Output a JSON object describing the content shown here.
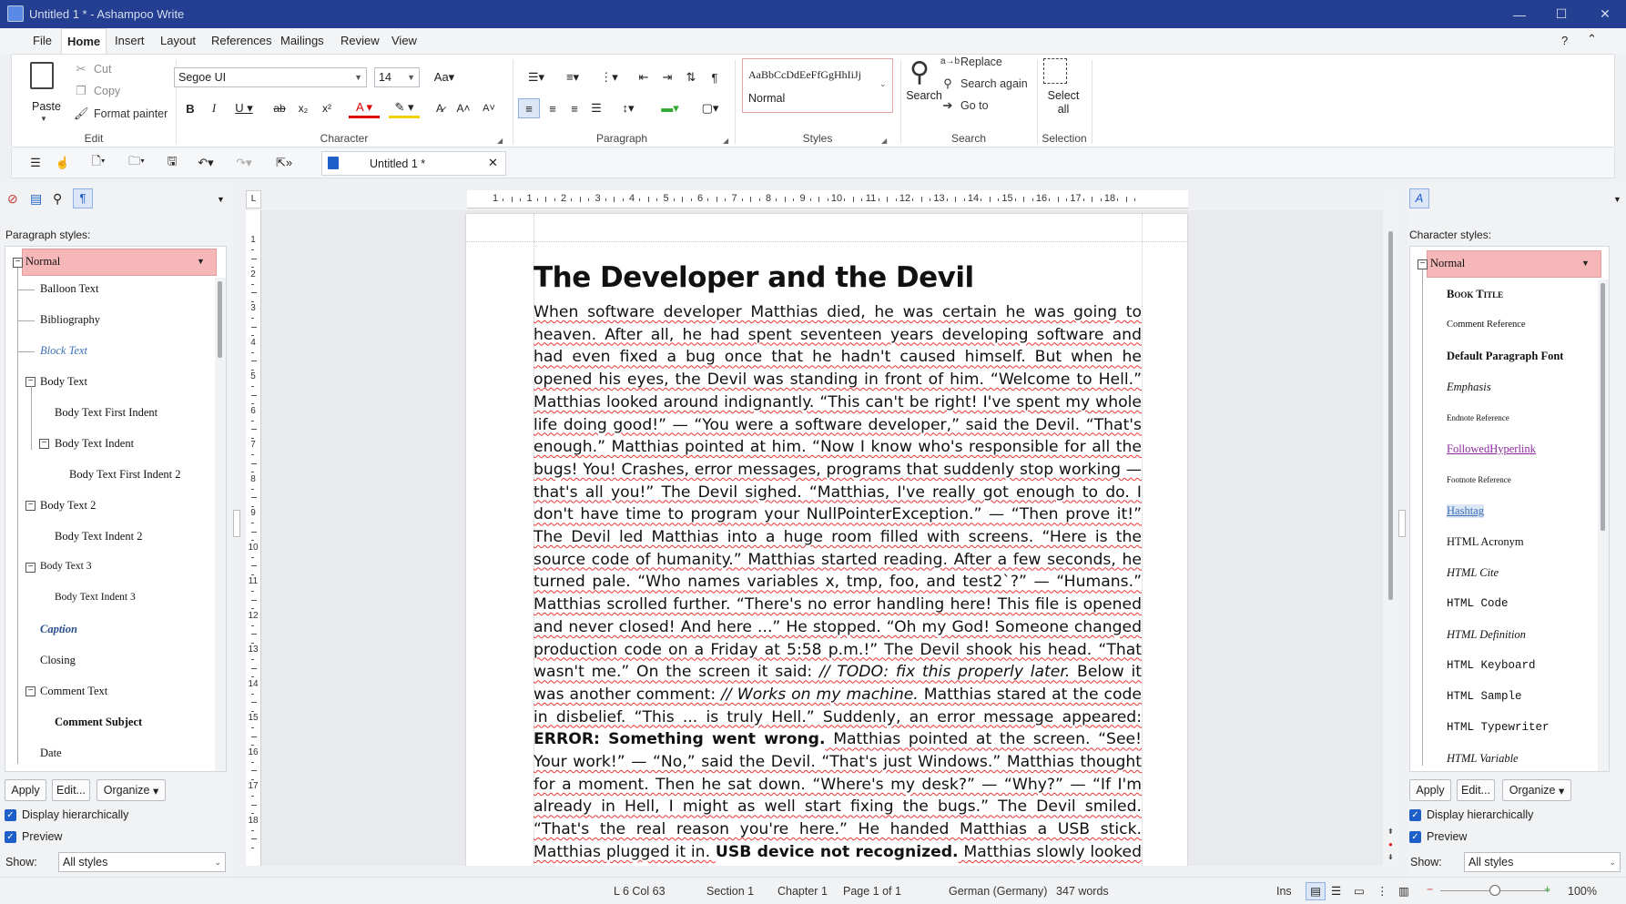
{
  "window": {
    "title": "Untitled 1 * - Ashampoo Write"
  },
  "menu": {
    "items": [
      "File",
      "Home",
      "Insert",
      "Layout",
      "References",
      "Mailings",
      "Review",
      "View"
    ],
    "active": "Home"
  },
  "ribbon": {
    "edit": {
      "label": "Edit",
      "paste": "Paste",
      "cut": "Cut",
      "copy": "Copy",
      "format_painter": "Format painter"
    },
    "character": {
      "label": "Character",
      "font": "Segoe UI",
      "size": "14"
    },
    "paragraph": {
      "label": "Paragraph"
    },
    "styles": {
      "label": "Styles",
      "preview": "AaBbCcDdEeFfGgHhIiJj",
      "current": "Normal"
    },
    "search": {
      "label": "Search",
      "search": "Search",
      "replace": "Replace",
      "search_again": "Search again",
      "go_to": "Go to"
    },
    "selection": {
      "label": "Selection",
      "select_all_line1": "Select",
      "select_all_line2": "all"
    }
  },
  "doc_tab": {
    "title": "Untitled 1 *"
  },
  "left_panel": {
    "label": "Paragraph styles:",
    "items": [
      "Normal",
      "Balloon Text",
      "Bibliography",
      "Block Text",
      "Body Text",
      "Body Text First Indent",
      "Body Text Indent",
      "Body Text First Indent 2",
      "Body Text 2",
      "Body Text Indent 2",
      "Body Text 3",
      "Body Text Indent 3",
      "Caption",
      "Closing",
      "Comment Text",
      "Comment Subject",
      "Date"
    ],
    "apply": "Apply",
    "edit": "Edit...",
    "organize": "Organize",
    "display_hier": "Display hierarchically",
    "preview": "Preview",
    "show_label": "Show:",
    "show_value": "All styles"
  },
  "right_panel": {
    "label": "Character styles:",
    "items": [
      "Normal",
      "Book Title",
      "Comment Reference",
      "Default Paragraph Font",
      "Emphasis",
      "Endnote Reference",
      "FollowedHyperlink",
      "Footnote Reference",
      "Hashtag",
      "HTML Acronym",
      "HTML Cite",
      "HTML Code",
      "HTML Definition",
      "HTML Keyboard",
      "HTML Sample",
      "HTML Typewriter",
      "HTML Variable"
    ],
    "apply": "Apply",
    "edit": "Edit...",
    "organize": "Organize",
    "display_hier": "Display hierarchically",
    "preview": "Preview",
    "show_label": "Show:",
    "show_value": "All styles"
  },
  "ruler": {
    "h_numbers": [
      "1",
      "1",
      "2",
      "3",
      "4",
      "5",
      "6",
      "7",
      "8",
      "9",
      "10",
      "11",
      "12",
      "13",
      "14",
      "15",
      "16",
      "17",
      "18"
    ],
    "v_numbers": [
      "1",
      "2",
      "3",
      "4",
      "5",
      "6",
      "7",
      "8",
      "9",
      "10",
      "11",
      "12",
      "13",
      "14",
      "15",
      "16",
      "17",
      "18"
    ]
  },
  "document": {
    "title": "The Developer and the Devil",
    "p1": "When software developer Matthias died, he was certain he was going to heaven. After all, he had spent seventeen years developing software and had even fixed a bug once that he hadn't caused himself. But when he opened his eyes, the Devil was standing in front of him. “Welcome to Hell.” Matthias looked around indignantly. “This can't be right! I've spent my whole life doing good!” — “You were a software developer,” said the Devil. “That's enough.” Matthias pointed at him. “Now I know who's responsible for all the bugs! You! Crashes, error messages, programs that suddenly stop working — that's all you!” The Devil sighed. “Matthias, I've really got enough to do. I don't have time to program your NullPointerException.” — “Then prove it!” The Devil led Matthias into a huge room filled with screens. “Here is the source code of humanity.” Matthias started reading. After a few seconds, he turned pale. “Who names variables x, tmp, foo, and test2`?” — “Humans.” Matthias scrolled further. “There's no error handling here! This file is opened and never closed! And here ...” He stopped. “Oh my God! Someone changed production code on a Friday at 5:58 p.m.!” The Devil shook his head. “That wasn't me.” On the screen it said: ",
    "todo": "// TODO: fix this properly later.",
    "p2": " Below it was another comment: ",
    "works": "// Works on my machine.",
    "p3": " Matthias stared at the code in disbelief. “This ... is truly Hell.” Suddenly, an error message appeared: ",
    "error": "ERROR: Something went wrong.",
    "p4": " Matthias pointed at the screen. “See! Your work!” — “No,” said the Devil. “That's just Windows.” Matthias thought for a moment. Then he sat down. “Where's my desk?” — “Why?” — “If I'm already in Hell, I might as well start fixing the bugs.” The Devil smiled. “That's the real reason you're here.” He handed Matthias a USB stick. Matthias plugged it in. ",
    "usb": "USB device not recognized.",
    "p5": " Matthias slowly looked at the Devil. The Devil raised both hands. “Okay ... that one was actually me.”"
  },
  "status": {
    "position": "L 6 Col 63",
    "section": "Section 1",
    "chapter": "Chapter 1",
    "page": "Page 1 of 1",
    "language": "German (Germany)",
    "words": "347 words",
    "mode": "Ins",
    "zoom": "100%",
    "zoom_fraction": 0.5
  },
  "colors": {
    "titlebar": "#243f91",
    "selected_style": "#f5b7b7",
    "accent": "#1f5fc9",
    "squiggle": "#e33333"
  }
}
